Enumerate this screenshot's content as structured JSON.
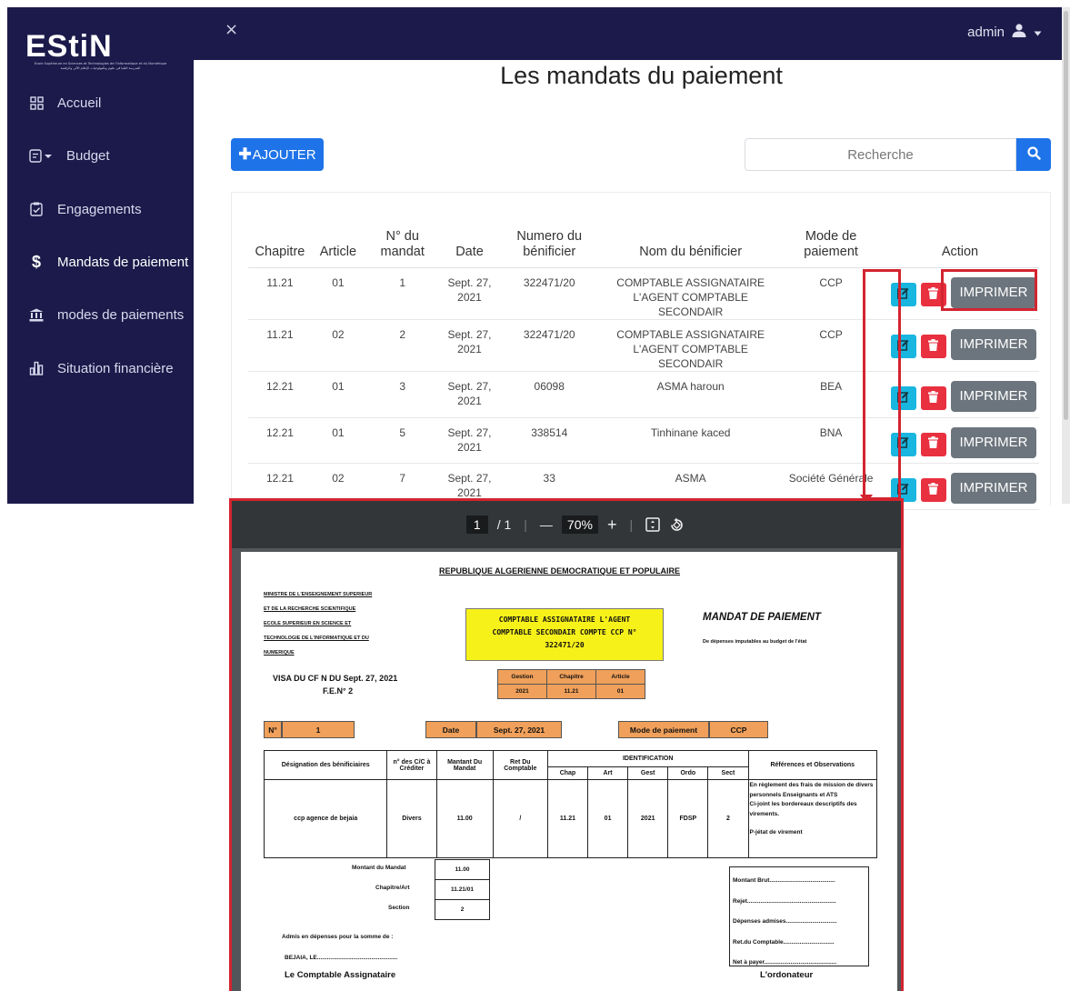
{
  "sidebar": {
    "logo": "EStiN",
    "logo_subtitle_fr": "Ecole Supérieure en Sciences et Technologies de l'Informatique et du Numérique",
    "logo_subtitle_ar": "المدرسة العليا في علوم وتكنولوجيات الإعلام الآلي والرقمنة",
    "items": [
      {
        "label": "Accueil",
        "icon": "grid-icon"
      },
      {
        "label": "Budget",
        "icon": "document-dropdown-icon"
      },
      {
        "label": "Engagements",
        "icon": "clipboard-check-icon"
      },
      {
        "label": "Mandats de paiement",
        "icon": "dollar-icon",
        "active": true
      },
      {
        "label": "modes de paiements",
        "icon": "bank-icon"
      },
      {
        "label": "Situation financière",
        "icon": "bar-chart-icon"
      }
    ]
  },
  "topbar": {
    "close": "×",
    "user": "admin"
  },
  "page": {
    "title": "Les mandats du paiement",
    "add_label": "AJOUTER",
    "search_placeholder": "Recherche"
  },
  "table": {
    "headers": [
      "Chapitre",
      "Article",
      "N° du mandat",
      "Date",
      "Numero du bénificier",
      "Nom du bénificier",
      "Mode de paiement",
      "Action"
    ],
    "rows": [
      {
        "chapitre": "11.21",
        "article": "01",
        "mandat": "1",
        "date": "Sept. 27, 2021",
        "numero": "322471/20",
        "nom": "COMPTABLE ASSIGNATAIRE L'AGENT COMPTABLE SECONDAIR",
        "mode": "CCP"
      },
      {
        "chapitre": "11.21",
        "article": "02",
        "mandat": "2",
        "date": "Sept. 27, 2021",
        "numero": "322471/20",
        "nom": "COMPTABLE ASSIGNATAIRE L'AGENT COMPTABLE SECONDAIR",
        "mode": "CCP"
      },
      {
        "chapitre": "12.21",
        "article": "01",
        "mandat": "3",
        "date": "Sept. 27, 2021",
        "numero": "06098",
        "nom": "ASMA haroun",
        "mode": "BEA"
      },
      {
        "chapitre": "12.21",
        "article": "01",
        "mandat": "5",
        "date": "Sept. 27, 2021",
        "numero": "338514",
        "nom": "Tinhinane kaced",
        "mode": "BNA"
      },
      {
        "chapitre": "12.21",
        "article": "02",
        "mandat": "7",
        "date": "Sept. 27, 2021",
        "numero": "33",
        "nom": "ASMA",
        "mode": "Société Générale"
      }
    ],
    "print_label": "IMPRIMER"
  },
  "colors": {
    "sidebar_bg": "#1b1a4a",
    "primary": "#1e73e8",
    "edit": "#19b6e0",
    "delete": "#e8303f",
    "print": "#6c757d",
    "highlight": "#d32430"
  },
  "pdf": {
    "toolbar": {
      "page": "1",
      "total": "/ 1",
      "zoom": "70%",
      "minus": "—",
      "plus": "+"
    },
    "republic": "REPUBLIQUE ALGERIENNE DEMOCRATIQUE ET POPULAIRE",
    "ministry_lines": [
      "MINISTRE DE L'ENSEIGNEMENT SUPERIEUR",
      "ET DE LA RECHERCHE SCIENTIFIQUE",
      "ECOLE SUPERIEUR EN SCIENCE ET",
      "TECHNOLOGIE DE L'INFORMATIQUE ET DU",
      "NUMERIQUE"
    ],
    "yellow_lines": [
      "COMPTABLE ASSIGNATAIRE L'AGENT",
      "COMPTABLE SECONDAIR COMPTE CCP N°",
      "322471/20"
    ],
    "mandat_title": "MANDAT DE PAIEMENT",
    "mandat_sub": "De dépenses imputables au budget de l'état",
    "visa": "VISA DU CF N DU Sept. 27, 2021",
    "fen": "F.E.N° 2",
    "gestion": {
      "headers": [
        "Gestion",
        "Chapitre",
        "Article"
      ],
      "values": [
        "2021",
        "11.21",
        "01"
      ]
    },
    "no_label": "N°",
    "no_value": "1",
    "date_label": "Date",
    "date_value": "Sept. 27, 2021",
    "mode_label": "Mode de paiement",
    "mode_value": "CCP",
    "main_headers": {
      "designation": "Désignation des bénificiaires",
      "cc": "n° des C/C à Créditer",
      "montant": "Mantant Du Mandat",
      "ret": "Ret Du Comptable",
      "identification": "IDENTIFICATION",
      "refs": "Références et Observations",
      "chap": "Chap",
      "art": "Art",
      "gest": "Gest",
      "ordo": "Ordo",
      "sect": "Sect"
    },
    "main_row": {
      "designation": "ccp agence de bejaia",
      "cc": "Divers",
      "montant": "11.00",
      "ret": "/",
      "chap": "11.21",
      "art": "01",
      "gest": "2021",
      "ordo": "FDSP",
      "sect": "2"
    },
    "observations": [
      "En règlement des frais de mission de divers personnels Enseignants et ATS",
      "Ci-joint les bordereaux descriptifs des virements.",
      "P-jétat de virement"
    ],
    "summary": [
      {
        "label": "Montant du Mandat",
        "value": "11.00"
      },
      {
        "label": "Chapitre/Art",
        "value": "11.21/01"
      },
      {
        "label": "Section",
        "value": "2"
      }
    ],
    "refbox": [
      "Montant Brut........................................",
      "Rejet......................................................",
      "Dépenses admises...............................",
      "Ret.du Comptable...............................",
      "Net à payer............................................"
    ],
    "admis": "Admis en dépenses pour la somme de :",
    "bejaia": "BEJAIA, LE.................................................",
    "comptable": "Le Comptable Assignataire",
    "ordonnateur": "L'ordonateur"
  }
}
